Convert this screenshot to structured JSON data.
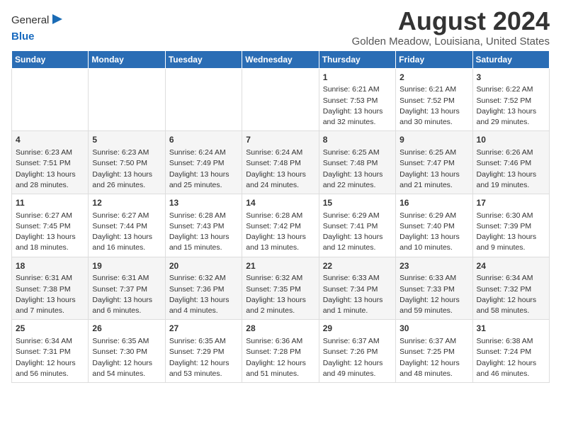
{
  "app": {
    "logo_general": "General",
    "logo_blue": "Blue",
    "title": "August 2024",
    "subtitle": "Golden Meadow, Louisiana, United States"
  },
  "calendar": {
    "headers": [
      "Sunday",
      "Monday",
      "Tuesday",
      "Wednesday",
      "Thursday",
      "Friday",
      "Saturday"
    ],
    "weeks": [
      [
        {
          "day": "",
          "text": ""
        },
        {
          "day": "",
          "text": ""
        },
        {
          "day": "",
          "text": ""
        },
        {
          "day": "",
          "text": ""
        },
        {
          "day": "1",
          "text": "Sunrise: 6:21 AM\nSunset: 7:53 PM\nDaylight: 13 hours\nand 32 minutes."
        },
        {
          "day": "2",
          "text": "Sunrise: 6:21 AM\nSunset: 7:52 PM\nDaylight: 13 hours\nand 30 minutes."
        },
        {
          "day": "3",
          "text": "Sunrise: 6:22 AM\nSunset: 7:52 PM\nDaylight: 13 hours\nand 29 minutes."
        }
      ],
      [
        {
          "day": "4",
          "text": "Sunrise: 6:23 AM\nSunset: 7:51 PM\nDaylight: 13 hours\nand 28 minutes."
        },
        {
          "day": "5",
          "text": "Sunrise: 6:23 AM\nSunset: 7:50 PM\nDaylight: 13 hours\nand 26 minutes."
        },
        {
          "day": "6",
          "text": "Sunrise: 6:24 AM\nSunset: 7:49 PM\nDaylight: 13 hours\nand 25 minutes."
        },
        {
          "day": "7",
          "text": "Sunrise: 6:24 AM\nSunset: 7:48 PM\nDaylight: 13 hours\nand 24 minutes."
        },
        {
          "day": "8",
          "text": "Sunrise: 6:25 AM\nSunset: 7:48 PM\nDaylight: 13 hours\nand 22 minutes."
        },
        {
          "day": "9",
          "text": "Sunrise: 6:25 AM\nSunset: 7:47 PM\nDaylight: 13 hours\nand 21 minutes."
        },
        {
          "day": "10",
          "text": "Sunrise: 6:26 AM\nSunset: 7:46 PM\nDaylight: 13 hours\nand 19 minutes."
        }
      ],
      [
        {
          "day": "11",
          "text": "Sunrise: 6:27 AM\nSunset: 7:45 PM\nDaylight: 13 hours\nand 18 minutes."
        },
        {
          "day": "12",
          "text": "Sunrise: 6:27 AM\nSunset: 7:44 PM\nDaylight: 13 hours\nand 16 minutes."
        },
        {
          "day": "13",
          "text": "Sunrise: 6:28 AM\nSunset: 7:43 PM\nDaylight: 13 hours\nand 15 minutes."
        },
        {
          "day": "14",
          "text": "Sunrise: 6:28 AM\nSunset: 7:42 PM\nDaylight: 13 hours\nand 13 minutes."
        },
        {
          "day": "15",
          "text": "Sunrise: 6:29 AM\nSunset: 7:41 PM\nDaylight: 13 hours\nand 12 minutes."
        },
        {
          "day": "16",
          "text": "Sunrise: 6:29 AM\nSunset: 7:40 PM\nDaylight: 13 hours\nand 10 minutes."
        },
        {
          "day": "17",
          "text": "Sunrise: 6:30 AM\nSunset: 7:39 PM\nDaylight: 13 hours\nand 9 minutes."
        }
      ],
      [
        {
          "day": "18",
          "text": "Sunrise: 6:31 AM\nSunset: 7:38 PM\nDaylight: 13 hours\nand 7 minutes."
        },
        {
          "day": "19",
          "text": "Sunrise: 6:31 AM\nSunset: 7:37 PM\nDaylight: 13 hours\nand 6 minutes."
        },
        {
          "day": "20",
          "text": "Sunrise: 6:32 AM\nSunset: 7:36 PM\nDaylight: 13 hours\nand 4 minutes."
        },
        {
          "day": "21",
          "text": "Sunrise: 6:32 AM\nSunset: 7:35 PM\nDaylight: 13 hours\nand 2 minutes."
        },
        {
          "day": "22",
          "text": "Sunrise: 6:33 AM\nSunset: 7:34 PM\nDaylight: 13 hours\nand 1 minute."
        },
        {
          "day": "23",
          "text": "Sunrise: 6:33 AM\nSunset: 7:33 PM\nDaylight: 12 hours\nand 59 minutes."
        },
        {
          "day": "24",
          "text": "Sunrise: 6:34 AM\nSunset: 7:32 PM\nDaylight: 12 hours\nand 58 minutes."
        }
      ],
      [
        {
          "day": "25",
          "text": "Sunrise: 6:34 AM\nSunset: 7:31 PM\nDaylight: 12 hours\nand 56 minutes."
        },
        {
          "day": "26",
          "text": "Sunrise: 6:35 AM\nSunset: 7:30 PM\nDaylight: 12 hours\nand 54 minutes."
        },
        {
          "day": "27",
          "text": "Sunrise: 6:35 AM\nSunset: 7:29 PM\nDaylight: 12 hours\nand 53 minutes."
        },
        {
          "day": "28",
          "text": "Sunrise: 6:36 AM\nSunset: 7:28 PM\nDaylight: 12 hours\nand 51 minutes."
        },
        {
          "day": "29",
          "text": "Sunrise: 6:37 AM\nSunset: 7:26 PM\nDaylight: 12 hours\nand 49 minutes."
        },
        {
          "day": "30",
          "text": "Sunrise: 6:37 AM\nSunset: 7:25 PM\nDaylight: 12 hours\nand 48 minutes."
        },
        {
          "day": "31",
          "text": "Sunrise: 6:38 AM\nSunset: 7:24 PM\nDaylight: 12 hours\nand 46 minutes."
        }
      ]
    ]
  }
}
